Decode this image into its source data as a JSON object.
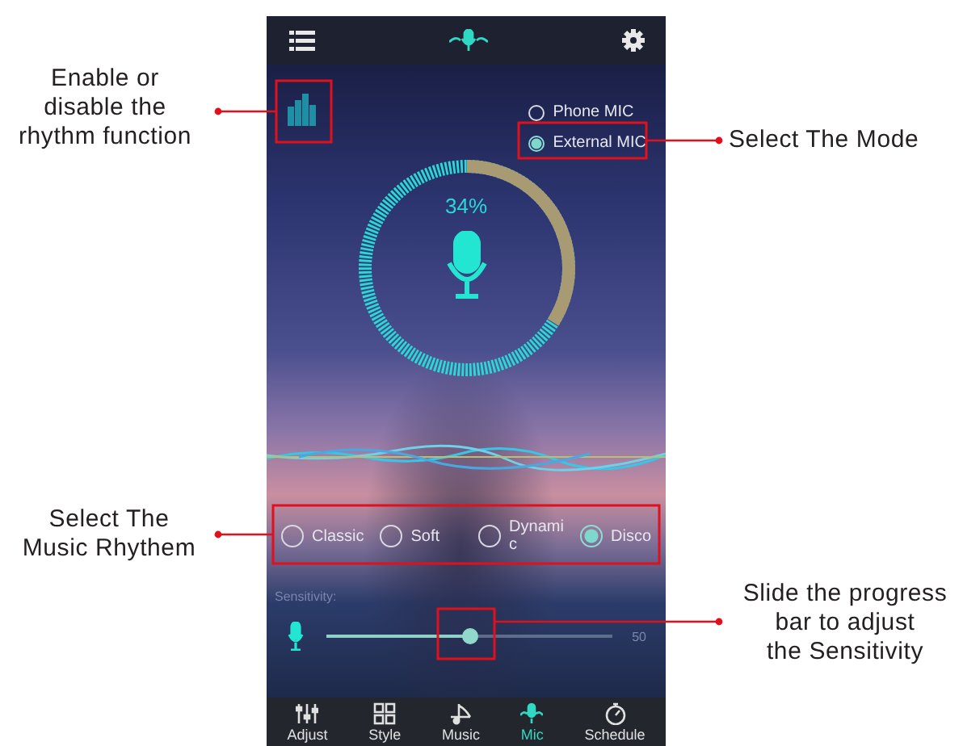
{
  "mode_options": [
    {
      "label": "Phone MIC",
      "selected": false
    },
    {
      "label": "External MIC",
      "selected": true
    }
  ],
  "meter": {
    "reading": "34%",
    "level": 0.34
  },
  "rhythm_options": [
    {
      "label": "Classic",
      "selected": false
    },
    {
      "label": "Soft",
      "selected": false
    },
    {
      "label": "Dynamic",
      "selected": false
    },
    {
      "label": "Disco",
      "selected": true
    }
  ],
  "sensitivity": {
    "label": "Sensitivity:",
    "level": 0.5,
    "reading": "50"
  },
  "bottom_nav": [
    {
      "label": "Adjust",
      "kind": "sliders",
      "selected": false
    },
    {
      "label": "Style",
      "kind": "grid",
      "selected": false
    },
    {
      "label": "Music",
      "kind": "note",
      "selected": false
    },
    {
      "label": "Mic",
      "kind": "mic",
      "selected": true
    },
    {
      "label": "Schedule",
      "kind": "timer",
      "selected": false
    }
  ],
  "annotations": [
    {
      "text": "Enable or\ndisable the\nrhythm function"
    },
    {
      "text": "Select The Mode"
    },
    {
      "text": "Select The\nMusic Rhythem"
    },
    {
      "text": "Slide the progress\nbar to adjust\nthe Sensitivity"
    }
  ]
}
